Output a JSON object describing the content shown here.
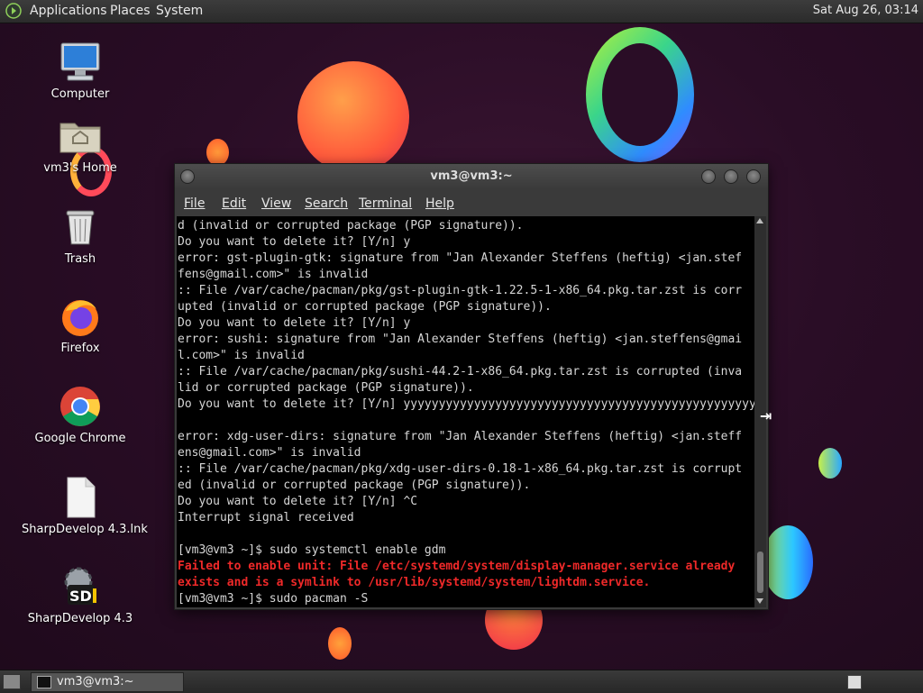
{
  "top_panel": {
    "menus": [
      "Applications",
      "Places",
      "System"
    ],
    "clock": "Sat Aug 26, 03:14"
  },
  "desktop_icons": [
    {
      "label": "Computer",
      "icon": "computer-icon"
    },
    {
      "label": "vm3's Home",
      "icon": "home-folder-icon"
    },
    {
      "label": "Trash",
      "icon": "trash-icon"
    },
    {
      "label": "Firefox",
      "icon": "firefox-icon"
    },
    {
      "label": "Google Chrome",
      "icon": "chrome-icon"
    },
    {
      "label": "SharpDevelop 4.3.lnk",
      "icon": "file-icon"
    },
    {
      "label": "SharpDevelop 4.3",
      "icon": "sharpdevelop-icon"
    }
  ],
  "terminal": {
    "title": "vm3@vm3:~",
    "menu": [
      "File",
      "Edit",
      "View",
      "Search",
      "Terminal",
      "Help"
    ],
    "lines": [
      {
        "text": "d (invalid or corrupted package (PGP signature)).",
        "err": false
      },
      {
        "text": "Do you want to delete it? [Y/n] y",
        "err": false
      },
      {
        "text": "error: gst-plugin-gtk: signature from \"Jan Alexander Steffens (heftig) <jan.stef",
        "err": false
      },
      {
        "text": "fens@gmail.com>\" is invalid",
        "err": false
      },
      {
        "text": ":: File /var/cache/pacman/pkg/gst-plugin-gtk-1.22.5-1-x86_64.pkg.tar.zst is corr",
        "err": false
      },
      {
        "text": "upted (invalid or corrupted package (PGP signature)).",
        "err": false
      },
      {
        "text": "Do you want to delete it? [Y/n] y",
        "err": false
      },
      {
        "text": "error: sushi: signature from \"Jan Alexander Steffens (heftig) <jan.steffens@gmai",
        "err": false
      },
      {
        "text": "l.com>\" is invalid",
        "err": false
      },
      {
        "text": ":: File /var/cache/pacman/pkg/sushi-44.2-1-x86_64.pkg.tar.zst is corrupted (inva",
        "err": false
      },
      {
        "text": "lid or corrupted package (PGP signature)).",
        "err": false
      },
      {
        "text": "Do you want to delete it? [Y/n] yyyyyyyyyyyyyyyyyyyyyyyyyyyyyyyyyyyyyyyyyyyyyyyyyyyy",
        "err": false
      },
      {
        "text": "",
        "err": false
      },
      {
        "text": "error: xdg-user-dirs: signature from \"Jan Alexander Steffens (heftig) <jan.steff",
        "err": false
      },
      {
        "text": "ens@gmail.com>\" is invalid",
        "err": false
      },
      {
        "text": ":: File /var/cache/pacman/pkg/xdg-user-dirs-0.18-1-x86_64.pkg.tar.zst is corrupt",
        "err": false
      },
      {
        "text": "ed (invalid or corrupted package (PGP signature)).",
        "err": false
      },
      {
        "text": "Do you want to delete it? [Y/n] ^C",
        "err": false
      },
      {
        "text": "Interrupt signal received",
        "err": false
      },
      {
        "text": "",
        "err": false
      },
      {
        "text": "[vm3@vm3 ~]$ sudo systemctl enable gdm",
        "err": false
      },
      {
        "text": "Failed to enable unit: File /etc/systemd/system/display-manager.service already",
        "err": true
      },
      {
        "text": "exists and is a symlink to /usr/lib/systemd/system/lightdm.service.",
        "err": true
      },
      {
        "text": "[vm3@vm3 ~]$ sudo pacman -S",
        "err": false
      }
    ]
  },
  "taskbar": {
    "window_button": "vm3@vm3:~"
  },
  "colors": {
    "error_text": "#ef2929",
    "terminal_bg": "#000000",
    "terminal_fg": "#d6d6d6"
  }
}
